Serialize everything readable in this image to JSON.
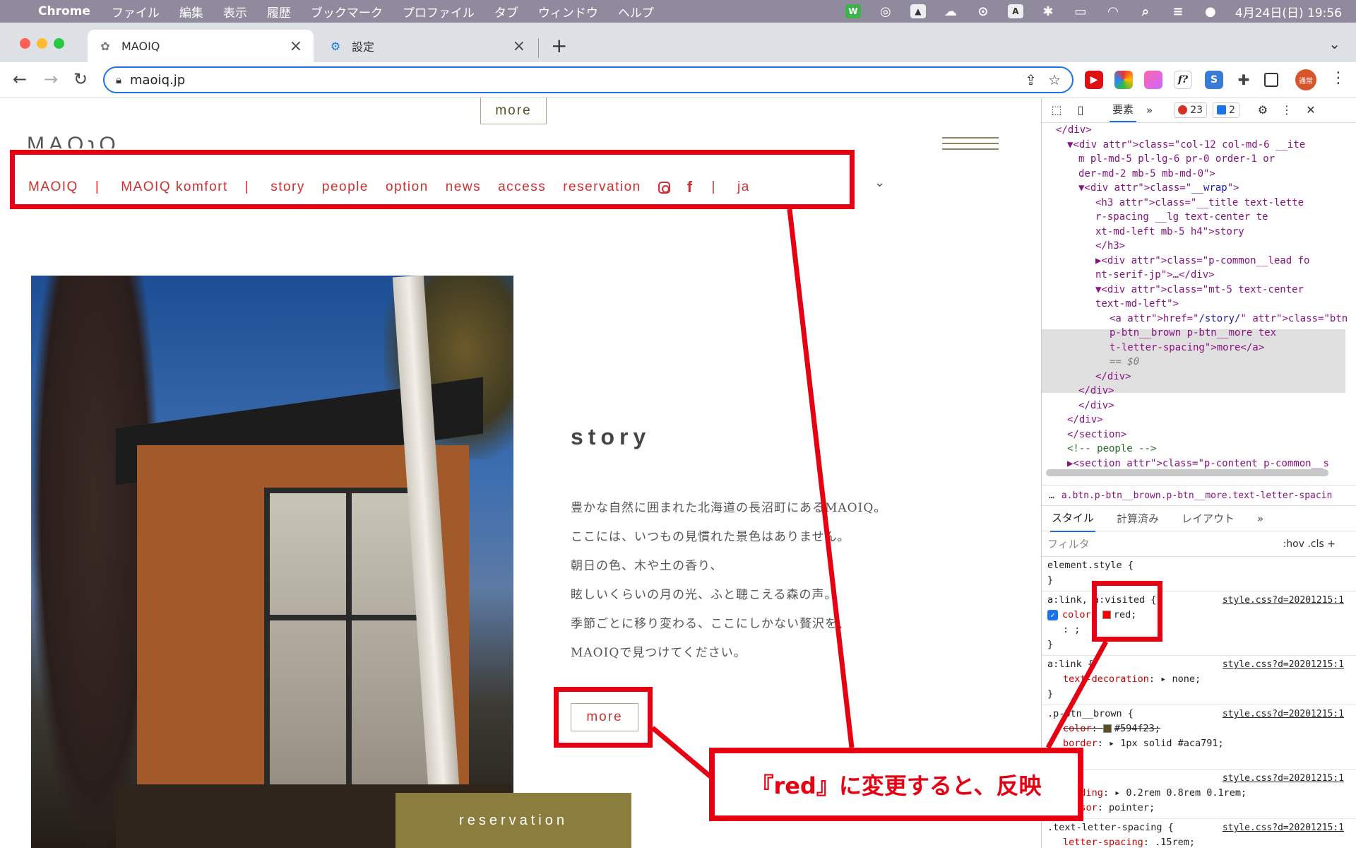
{
  "menubar": {
    "app": "Chrome",
    "items": [
      "ファイル",
      "編集",
      "表示",
      "履歴",
      "ブックマーク",
      "プロファイル",
      "タブ",
      "ウィンドウ",
      "ヘルプ"
    ],
    "tray_icons": [
      "W",
      "A"
    ],
    "clock": "4月24日(日) 19:56"
  },
  "tabs": [
    {
      "title": "MAOIQ",
      "icon": "flower-favicon"
    },
    {
      "title": "設定",
      "icon": "gear-icon"
    }
  ],
  "toolbar": {
    "url": "maoiq.jp",
    "profile_label": "通常"
  },
  "site": {
    "top_more": "more",
    "logo": "MAOɿQ",
    "nav": {
      "maoiq": "MAOIQ",
      "sep1": "|",
      "komfort": "MAOIQ komfort",
      "sep2": "|",
      "story": "story",
      "people": "people",
      "option": "option",
      "news": "news",
      "access": "access",
      "reservation": "reservation",
      "facebook": "f",
      "sep3": "|",
      "lang": "ja"
    },
    "story": {
      "title": "story",
      "lines": [
        "豊かな自然に囲まれた北海道の長沼町にあるMAOIQ。",
        "ここには、いつもの見慣れた景色はありません。",
        "朝日の色、木や土の香り、",
        "眩しいくらいの月の光、ふと聴こえる森の声。",
        "季節ごとに移り変わる、ここにしかない贅沢を、",
        "MAOIQで見つけてください。"
      ],
      "more": "more"
    },
    "reservation_button": "reservation"
  },
  "devtools": {
    "panel_tab": "要素",
    "more_tabs": "»",
    "errors": "23",
    "messages": "2",
    "dom_lines": [
      {
        "indent": 0,
        "html": "</div>"
      },
      {
        "indent": 1,
        "html": "▼<div class=\"col-12 col-md-6 __ite"
      },
      {
        "indent": 2,
        "html": "m pl-md-5 pl-lg-6 pr-0 order-1 or"
      },
      {
        "indent": 2,
        "html": "der-md-2 mb-5 mb-md-0\">"
      },
      {
        "indent": 2,
        "html": "▼<div class=\"__wrap\">"
      },
      {
        "indent": 3,
        "html": "<h3 class=\"__title text-lette"
      },
      {
        "indent": 3,
        "html": "r-spacing __lg text-center te"
      },
      {
        "indent": 3,
        "html": "xt-md-left mb-5 h4\">story"
      },
      {
        "indent": 3,
        "html": "</h3>"
      },
      {
        "indent": 3,
        "html": "▶<div class=\"p-common__lead fo"
      },
      {
        "indent": 3,
        "html": "nt-serif-jp\">…</div>"
      },
      {
        "indent": 3,
        "html": "▼<div class=\"mt-5 text-center"
      },
      {
        "indent": 3,
        "html": "text-md-left\">"
      },
      {
        "indent": 4,
        "html": "<a href=\"/story/\" class=\"btn"
      },
      {
        "indent": 4,
        "html": "p-btn__brown p-btn__more tex"
      },
      {
        "indent": 4,
        "html": "t-letter-spacing\">more</a>"
      },
      {
        "indent": 4,
        "html": "== $0"
      },
      {
        "indent": 3,
        "html": "</div>"
      },
      {
        "indent": 2,
        "html": "</div>"
      },
      {
        "indent": 2,
        "html": "</div>"
      },
      {
        "indent": 1,
        "html": "</div>"
      },
      {
        "indent": 1,
        "html": "</section>"
      },
      {
        "indent": 1,
        "html": "<!-- people -->"
      },
      {
        "indent": 1,
        "html": "▶<section class=\"p-content p-common__s"
      }
    ],
    "breadcrumb": "a.btn.p-btn__brown.p-btn__more.text-letter-spacin",
    "style_tabs": [
      "スタイル",
      "計算済み",
      "レイアウト",
      "»"
    ],
    "filter_placeholder": "フィルタ",
    "filter_tools": ":hov  .cls  +",
    "rules": {
      "element_style": "element.style {",
      "close": "}",
      "link_visited_sel": "a:link, a:visited {",
      "link_visited_src": "style.css?d=20201215:1",
      "color_prop": "color",
      "color_val": "red;",
      "semicolons": ": ;",
      "link_sel": "a:link {",
      "link_src": "style.css?d=20201215:1",
      "textdeco_prop": "text-decoration",
      "textdeco_val": "none;",
      "brown_sel": ".p-btn__brown {",
      "brown_src": "style.css?d=20201215:1",
      "brown_color_prop": "color",
      "brown_color_val": "#594f23;",
      "border_prop": "border",
      "border_val": "1px solid #aca791;",
      "src4": "style.css?d=20201215:1",
      "padding_prop": "padding",
      "padding_val": "0.2rem 0.8rem 0.1rem;",
      "cursor_prop": "cursor",
      "cursor_val": "pointer;",
      "ls_sel": ".text-letter-spacing {",
      "ls_src": "style.css?d=20201215:1",
      "ls_prop": "letter-spacing",
      "ls_val": ".15rem;"
    }
  },
  "annotation": {
    "callout": "『red』に変更すると、反映"
  },
  "colors": {
    "highlight": "#e60012",
    "brand_brown": "#594f23",
    "border_beige": "#aca791",
    "reservation_bg": "#8a7d3e"
  }
}
